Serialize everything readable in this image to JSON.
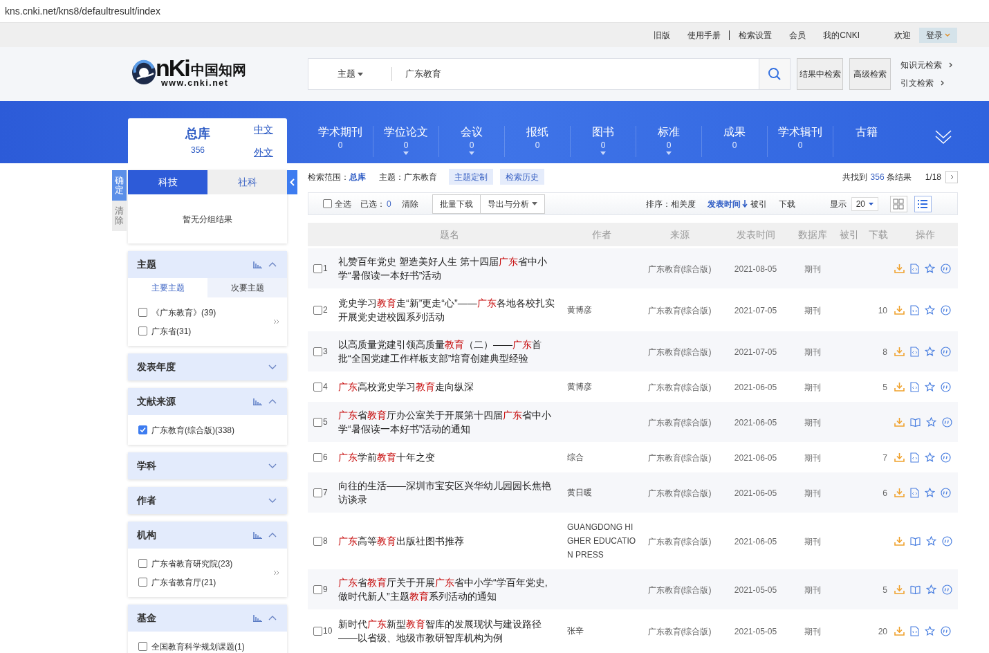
{
  "address_bar": {
    "url": "kns.cnki.net/kns8/defaultresult/index"
  },
  "top_links": [
    {
      "label": "旧版",
      "separator": false
    },
    {
      "label": "使用手册",
      "separator": true
    },
    {
      "label": "检索设置",
      "separator": false
    },
    {
      "label": "会员",
      "separator": false
    },
    {
      "label": "我的CNKI",
      "separator": false
    }
  ],
  "welcome": "欢迎",
  "login": "登录",
  "logo": {
    "mark": "nKi",
    "name": "中国知网",
    "url": "www.cnki.net"
  },
  "search": {
    "field": "主题",
    "value": "广东教育"
  },
  "search_buttons": [
    "结果中检索",
    "高级检索"
  ],
  "side_links": [
    "知识元检索",
    "引文检索"
  ],
  "database": {
    "title": "总库",
    "count": "356",
    "links": [
      "中文",
      "外文"
    ]
  },
  "nav": [
    {
      "label": "学术期刊",
      "count": "0",
      "has_menu": false
    },
    {
      "label": "学位论文",
      "count": "0",
      "has_menu": true
    },
    {
      "label": "会议",
      "count": "0",
      "has_menu": true
    },
    {
      "label": "报纸",
      "count": "0",
      "has_menu": false
    },
    {
      "label": "图书",
      "count": "0",
      "has_menu": true
    },
    {
      "label": "标准",
      "count": "0",
      "has_menu": true
    },
    {
      "label": "成果",
      "count": "0",
      "has_menu": false
    },
    {
      "label": "学术辑刊",
      "count": "0",
      "has_menu": false
    },
    {
      "label": "古籍",
      "has_menu": false
    }
  ],
  "filter_actions": [
    {
      "label": "确定",
      "primary": true
    },
    {
      "label": "清除",
      "primary": false
    }
  ],
  "group_tabs": [
    {
      "label": "科技",
      "selected": true
    },
    {
      "label": "社科",
      "selected": false
    }
  ],
  "group_empty": "暂无分组结果",
  "facets": [
    {
      "title": "主题",
      "expanded": true,
      "has_more": true,
      "subtabs": [
        {
          "label": "主要主题",
          "selected": true
        },
        {
          "label": "次要主题",
          "selected": false
        }
      ],
      "items": [
        {
          "label": "《广东教育》(39)",
          "checked": false
        },
        {
          "label": "广东省(31)",
          "checked": false
        }
      ]
    },
    {
      "title": "发表年度",
      "expanded": false
    },
    {
      "title": "文献来源",
      "expanded": true,
      "has_more": false,
      "items": [
        {
          "label": "广东教育(综合版)(338)",
          "checked": true
        }
      ]
    },
    {
      "title": "学科",
      "expanded": false
    },
    {
      "title": "作者",
      "expanded": false
    },
    {
      "title": "机构",
      "expanded": true,
      "has_more": true,
      "items": [
        {
          "label": "广东省教育研究院(23)",
          "checked": false
        },
        {
          "label": "广东省教育厅(21)",
          "checked": false
        }
      ]
    },
    {
      "title": "基金",
      "expanded": true,
      "has_more": false,
      "items": [
        {
          "label": "全国教育科学规划课题(1)",
          "checked": false
        }
      ]
    }
  ],
  "scope": {
    "label": "检索范围：",
    "value": "总库"
  },
  "query": {
    "label": "主题：",
    "value": "广东教育"
  },
  "chips": [
    "主题定制",
    "检索历史"
  ],
  "result_count": {
    "prefix": "共找到",
    "count": "356",
    "suffix": "条结果"
  },
  "page": "1/18",
  "toolbar": {
    "select_all": {
      "label": "全选",
      "checked": false
    },
    "selected_label": "已选：",
    "selected_count": "0",
    "clear": "清除",
    "buttons": [
      {
        "label": "批量下载",
        "has_menu": false
      },
      {
        "label": "导出与分析",
        "has_menu": true
      }
    ],
    "sort_label": "排序：",
    "sort_options": [
      {
        "label": "相关度",
        "selected": false
      },
      {
        "label": "发表时间",
        "selected": true
      },
      {
        "label": "被引",
        "selected": false
      },
      {
        "label": "下载",
        "selected": false
      }
    ],
    "show_label": "显示",
    "page_size": "20",
    "views": [
      {
        "kind": "grid",
        "selected": false
      },
      {
        "kind": "list",
        "selected": true
      }
    ]
  },
  "table": {
    "columns": [
      "题名",
      "作者",
      "来源",
      "发表时间",
      "数据库",
      "被引",
      "下载",
      "操作"
    ],
    "rows": [
      {
        "number": "1",
        "checked": false,
        "title": [
          {
            "text": "礼赞百年党史 塑造美好人生 第十四届",
            "hit": false
          },
          {
            "text": "广东",
            "hit": true
          },
          {
            "text": "省中小学“暑假读一本好书”活动",
            "hit": false
          }
        ],
        "source": "广东教育(综合版)",
        "date": "2021-08-05",
        "database": "期刊",
        "kind": "html"
      },
      {
        "number": "2",
        "checked": false,
        "title": [
          {
            "text": "党史学习",
            "hit": false
          },
          {
            "text": "教育",
            "hit": true
          },
          {
            "text": "走“新”更走“心”——",
            "hit": false
          },
          {
            "text": "广东",
            "hit": true
          },
          {
            "text": "各地各校扎实开展党史进校园系列活动",
            "hit": false
          }
        ],
        "author": "黄博彦",
        "source": "广东教育(综合版)",
        "date": "2021-07-05",
        "database": "期刊",
        "downloads": "10",
        "kind": "html"
      },
      {
        "number": "3",
        "checked": false,
        "title": [
          {
            "text": "以高质量党建引领高质量",
            "hit": false
          },
          {
            "text": "教育",
            "hit": true
          },
          {
            "text": "（二）——",
            "hit": false
          },
          {
            "text": "广东",
            "hit": true
          },
          {
            "text": "首批“全国党建工作样板支部”培育创建典型经验",
            "hit": false
          }
        ],
        "source": "广东教育(综合版)",
        "date": "2021-07-05",
        "database": "期刊",
        "downloads": "8",
        "kind": "html"
      },
      {
        "number": "4",
        "checked": false,
        "title": [
          {
            "text": "广东",
            "hit": true
          },
          {
            "text": "高校党史学习",
            "hit": false
          },
          {
            "text": "教育",
            "hit": true
          },
          {
            "text": "走向纵深",
            "hit": false
          }
        ],
        "author": "黄博彦",
        "source": "广东教育(综合版)",
        "date": "2021-06-05",
        "database": "期刊",
        "downloads": "5",
        "kind": "html"
      },
      {
        "number": "5",
        "checked": false,
        "title": [
          {
            "text": "广东",
            "hit": true
          },
          {
            "text": "省",
            "hit": false
          },
          {
            "text": "教育",
            "hit": true
          },
          {
            "text": "厅办公室关于开展第十四届",
            "hit": false
          },
          {
            "text": "广东",
            "hit": true
          },
          {
            "text": "省中小学“暑假读一本好书”活动的通知",
            "hit": false
          }
        ],
        "source": "广东教育(综合版)",
        "date": "2021-06-05",
        "database": "期刊",
        "kind": "book"
      },
      {
        "number": "6",
        "checked": false,
        "title": [
          {
            "text": "广东",
            "hit": true
          },
          {
            "text": "学前",
            "hit": false
          },
          {
            "text": "教育",
            "hit": true
          },
          {
            "text": "十年之变",
            "hit": false
          }
        ],
        "author": "综合",
        "source": "广东教育(综合版)",
        "date": "2021-06-05",
        "database": "期刊",
        "downloads": "7",
        "kind": "html"
      },
      {
        "number": "7",
        "checked": false,
        "title": [
          {
            "text": "向往的生活——深圳市宝安区兴华幼儿园园长焦艳访谈录",
            "hit": false
          }
        ],
        "author": "黄日暖",
        "source": "广东教育(综合版)",
        "date": "2021-06-05",
        "database": "期刊",
        "downloads": "6",
        "kind": "html"
      },
      {
        "number": "8",
        "checked": false,
        "title": [
          {
            "text": "广东",
            "hit": true
          },
          {
            "text": "高等",
            "hit": false
          },
          {
            "text": "教育",
            "hit": true
          },
          {
            "text": "出版社图书推荐",
            "hit": false
          }
        ],
        "author": "GUANGDONG HIGHER EDUCATION PRESS",
        "source": "广东教育(综合版)",
        "date": "2021-06-05",
        "database": "期刊",
        "kind": "book"
      },
      {
        "number": "9",
        "checked": false,
        "title": [
          {
            "text": "广东",
            "hit": true
          },
          {
            "text": "省",
            "hit": false
          },
          {
            "text": "教育",
            "hit": true
          },
          {
            "text": "厅关于开展",
            "hit": false
          },
          {
            "text": "广东",
            "hit": true
          },
          {
            "text": "省中小学“学百年党史,做时代新人”主题",
            "hit": false
          },
          {
            "text": "教育",
            "hit": true
          },
          {
            "text": "系列活动的通知",
            "hit": false
          }
        ],
        "source": "广东教育(综合版)",
        "date": "2021-05-05",
        "database": "期刊",
        "downloads": "5",
        "kind": "book"
      },
      {
        "number": "10",
        "checked": false,
        "title": [
          {
            "text": "新时代",
            "hit": false
          },
          {
            "text": "广东",
            "hit": true
          },
          {
            "text": "新型",
            "hit": false
          },
          {
            "text": "教育",
            "hit": true
          },
          {
            "text": "智库的发展现状与建设路径——以省级、地级市教研智库机构为例",
            "hit": false
          }
        ],
        "author": "张辛",
        "source": "广东教育(综合版)",
        "date": "2021-05-05",
        "database": "期刊",
        "downloads": "20",
        "kind": "html"
      }
    ]
  }
}
